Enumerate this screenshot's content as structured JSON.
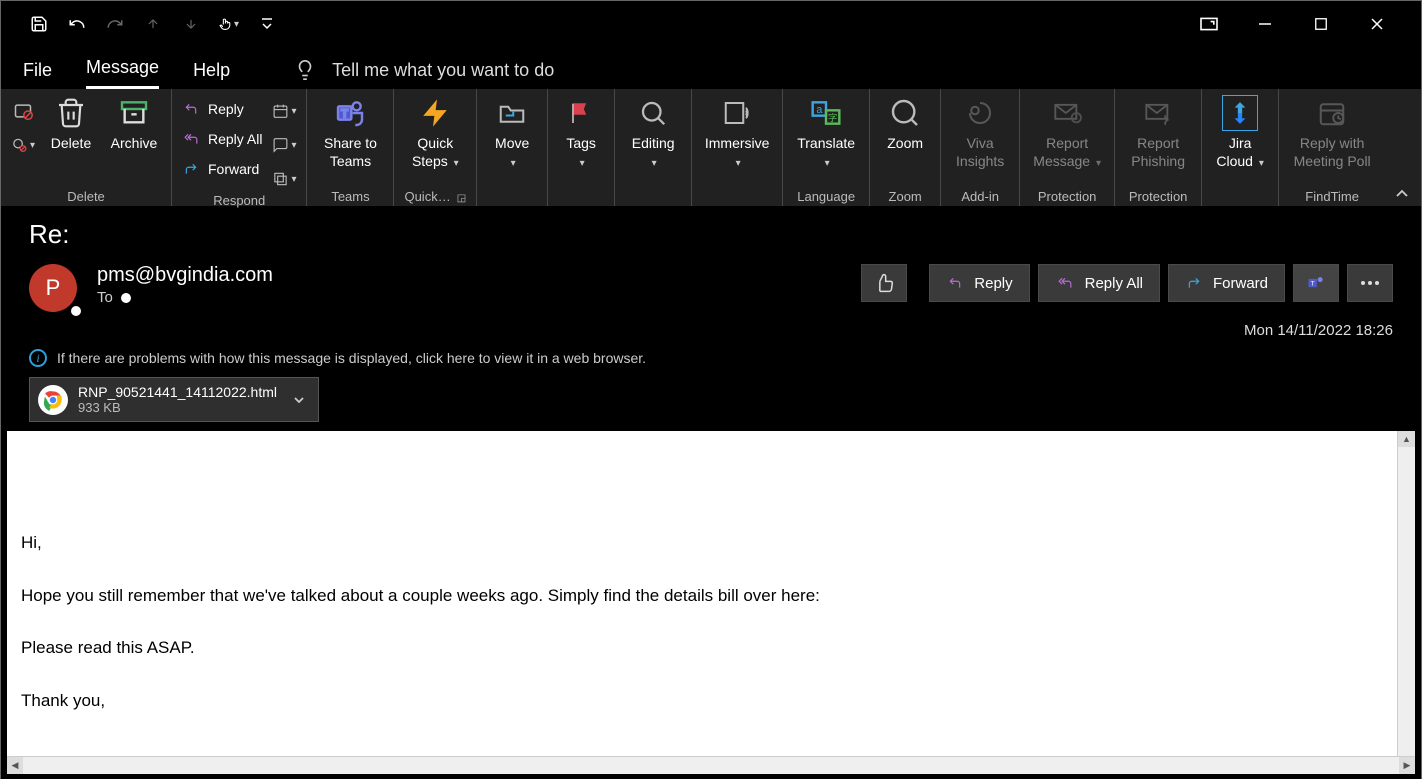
{
  "titlebar": {
    "qat_icons": [
      "save-icon",
      "undo-icon",
      "redo-icon",
      "arrow-up-icon",
      "arrow-down-icon",
      "touch-icon",
      "dropdown-icon",
      "customize-icon"
    ]
  },
  "tabs": {
    "file": "File",
    "message": "Message",
    "help": "Help",
    "tellme": "Tell me what you want to do"
  },
  "ribbon": {
    "delete_group": {
      "label": "Delete",
      "delete": "Delete",
      "archive": "Archive"
    },
    "respond_group": {
      "label": "Respond",
      "reply": "Reply",
      "replyall": "Reply All",
      "forward": "Forward"
    },
    "teams_group": {
      "label": "Teams",
      "share": "Share to Teams"
    },
    "quick_group": {
      "label": "Quick…",
      "quick": "Quick Steps"
    },
    "move_group": {
      "move": "Move"
    },
    "tags_group": {
      "tags": "Tags"
    },
    "editing_group": {
      "editing": "Editing"
    },
    "immersive_group": {
      "immersive": "Immersive"
    },
    "language_group": {
      "label": "Language",
      "translate": "Translate"
    },
    "zoom_group": {
      "label": "Zoom",
      "zoom": "Zoom"
    },
    "addin_group": {
      "label": "Add-in",
      "viva": "Viva Insights"
    },
    "protection1": {
      "label": "Protection",
      "report": "Report Message"
    },
    "protection2": {
      "label": "Protection",
      "phish": "Report Phishing"
    },
    "jira_group": {
      "jira": "Jira Cloud"
    },
    "findtime_group": {
      "label": "FindTime",
      "poll": "Reply with Meeting Poll"
    }
  },
  "header": {
    "subject": "Re:",
    "avatar_initial": "P",
    "from": "pms@bvgindia.com",
    "to_label": "To",
    "date": "Mon 14/11/2022 18:26",
    "infobar": "If there are problems with how this message is displayed, click here to view it in a web browser.",
    "attachment": {
      "name": "RNP_90521441_14112022.html",
      "size": "933 KB"
    },
    "actions": {
      "reply": "Reply",
      "replyall": "Reply All",
      "forward": "Forward"
    }
  },
  "body": {
    "p1": "Hi,",
    "p2": "Hope you still remember that we've talked about a couple weeks ago. Simply find the details bill over here:",
    "p3": "Please read this ASAP.",
    "p4": "Thank you,"
  }
}
